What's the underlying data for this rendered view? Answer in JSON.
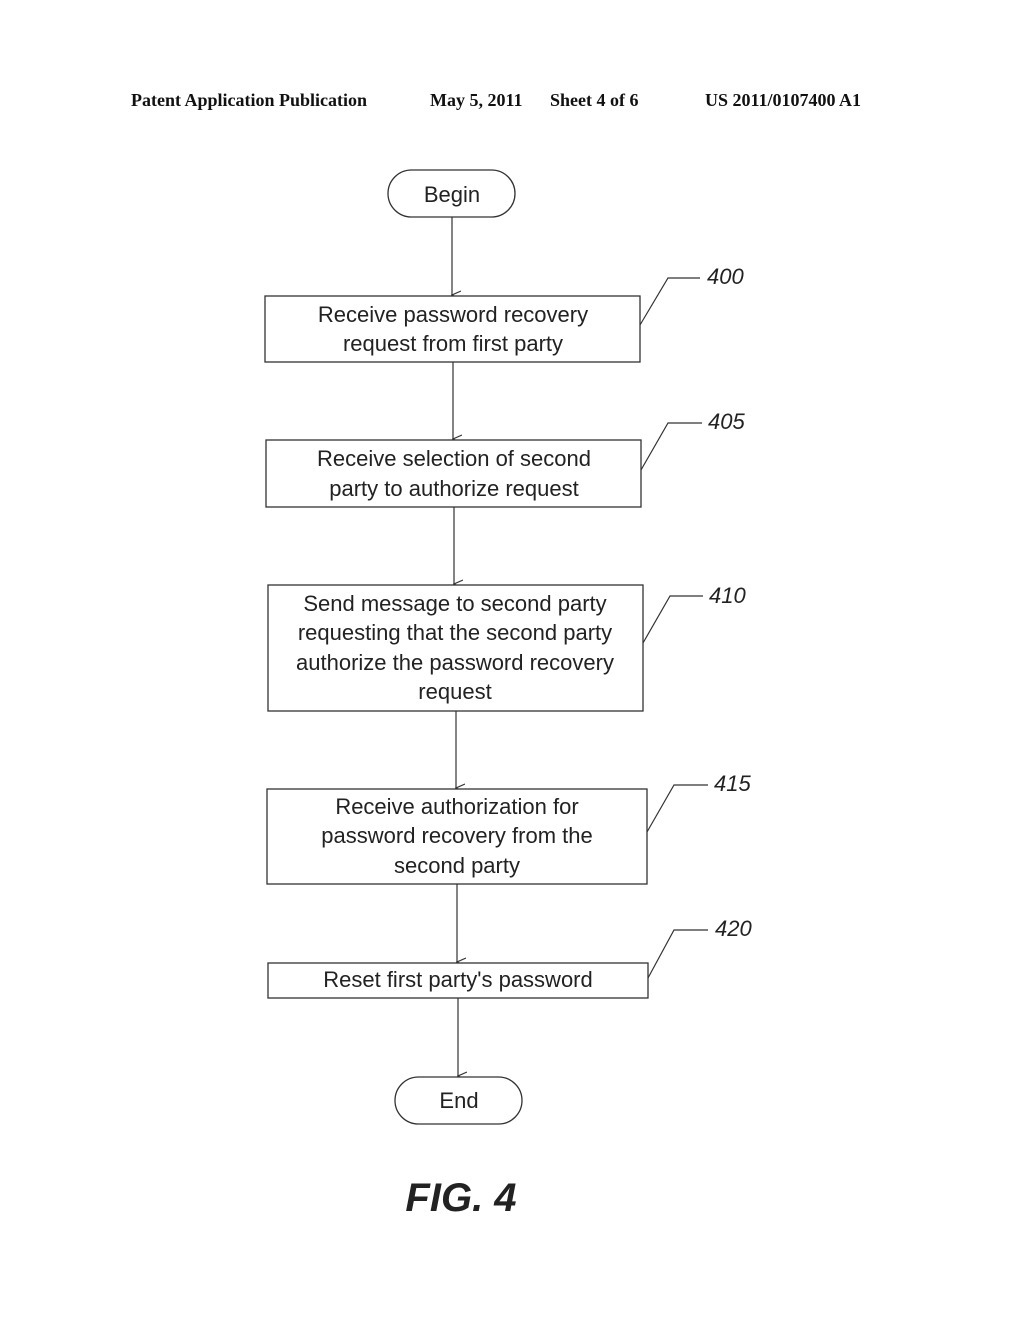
{
  "header": {
    "publication": "Patent Application Publication",
    "date": "May 5, 2011",
    "sheet": "Sheet 4 of 6",
    "number": "US 2011/0107400 A1"
  },
  "flowchart": {
    "begin": "Begin",
    "end": "End",
    "steps": [
      {
        "ref": "400",
        "lines": [
          "Receive password recovery",
          "request from first party"
        ]
      },
      {
        "ref": "405",
        "lines": [
          "Receive selection of second",
          "party to authorize request"
        ]
      },
      {
        "ref": "410",
        "lines": [
          "Send message to second party",
          "requesting that the second party",
          "authorize the password recovery",
          "request"
        ]
      },
      {
        "ref": "415",
        "lines": [
          "Receive authorization for",
          "password recovery from the",
          "second party"
        ]
      },
      {
        "ref": "420",
        "lines": [
          "Reset first party's password"
        ]
      }
    ]
  },
  "figure_label": "FIG. 4"
}
